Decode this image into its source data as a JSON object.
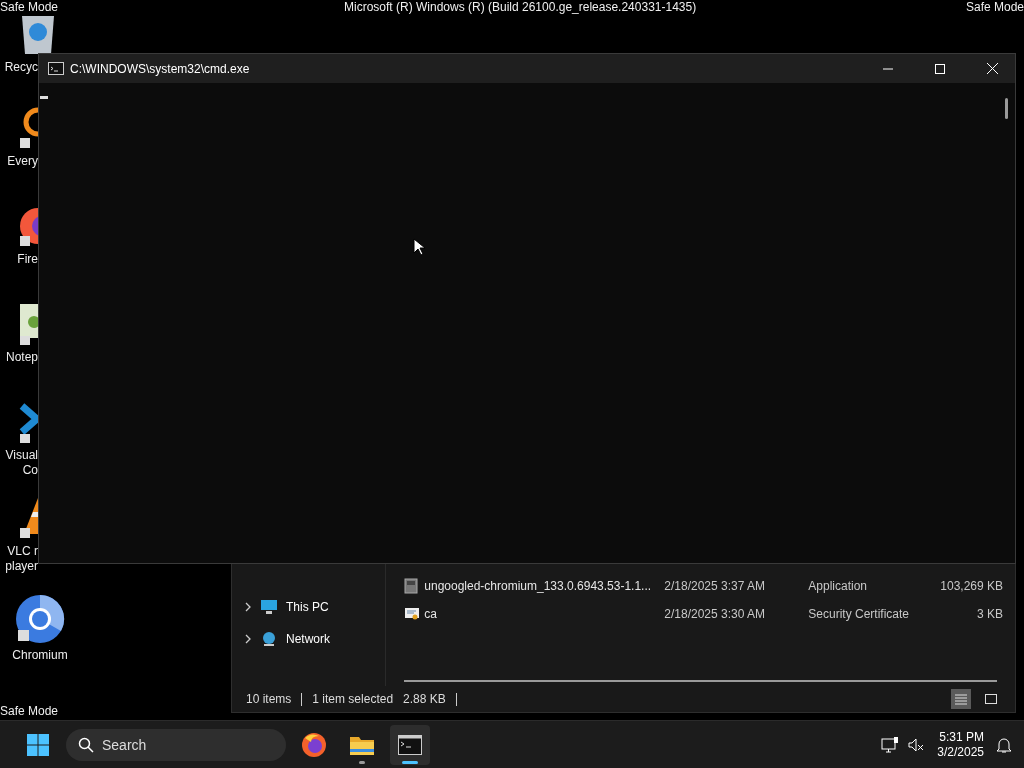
{
  "desktop_captions": [
    {
      "kind": "top-left",
      "text": "Safe Mode"
    },
    {
      "kind": "top-center",
      "text": "Microsoft (R) Windows (R) (Build 26100.ge_release.240331-1435)"
    },
    {
      "kind": "top-right",
      "text": "Safe Mode"
    },
    {
      "kind": "bottom-left",
      "text": "Safe Mode"
    }
  ],
  "desktop_icons": [
    {
      "kind": "recycle",
      "label": [
        "Recyc"
      ],
      "clipped": true
    },
    {
      "kind": "search-app",
      "label": [
        "Every"
      ],
      "clipped": true
    },
    {
      "kind": "browser",
      "label": [
        "Fire"
      ],
      "clipped": true
    },
    {
      "kind": "notepad",
      "label": [
        "Notep"
      ],
      "clipped": true
    },
    {
      "kind": "code",
      "label": [
        "Visual",
        "Co"
      ],
      "clipped": true
    },
    {
      "kind": "cone",
      "label": [
        "VLC r",
        "player"
      ],
      "clipped": true
    },
    {
      "kind": "chromium",
      "label": [
        "Chromium"
      ],
      "clipped": false
    }
  ],
  "cmd_window": {
    "title": "C:\\WINDOWS\\system32\\cmd.exe"
  },
  "explorer": {
    "nav": [
      {
        "kind": "pc",
        "label": "This PC",
        "expanded": false
      },
      {
        "kind": "network",
        "label": "Network",
        "expanded": false
      }
    ],
    "files": [
      {
        "kind": "application",
        "name": "ungoogled-chromium_133.0.6943.53-1.1...",
        "date": "2/18/2025 3:37 AM",
        "type": "Application",
        "size": "103,269 KB"
      },
      {
        "kind": "certificate",
        "name": "ca",
        "date": "2/18/2025 3:30 AM",
        "type": "Security Certificate",
        "size": "3 KB"
      }
    ],
    "status": {
      "count": "10 items",
      "selection": "1 item selected",
      "size": "2.88 KB"
    },
    "views": [
      {
        "kind": "details",
        "selected": true
      },
      {
        "kind": "tiles",
        "selected": false
      }
    ]
  },
  "taskbar": {
    "search": {
      "placeholder": "Search"
    },
    "apps": [
      {
        "kind": "firefox",
        "running": false,
        "active": false
      },
      {
        "kind": "folder",
        "running": true,
        "active": false
      },
      {
        "kind": "terminal",
        "running": true,
        "active": true
      }
    ],
    "time": "5:31 PM",
    "date": "3/2/2025"
  }
}
